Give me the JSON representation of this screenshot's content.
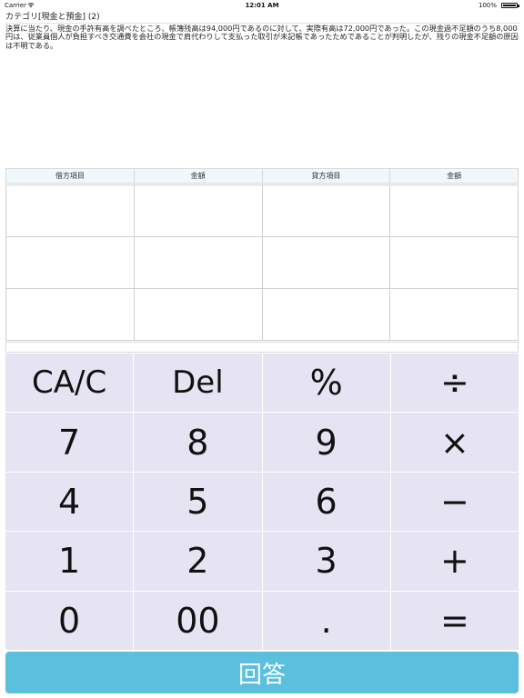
{
  "status_bar": {
    "carrier": "Carrier",
    "time": "12:01 AM",
    "battery": "100%"
  },
  "header": {
    "category": "カテゴリ[現金と預金] (2)"
  },
  "question": {
    "text": "決算に当たり、現金の手許有高を調べたところ、帳簿残高は94,000円であるのに対して、実際有高は72,000円であった。この現金過不足額のうち8,000円は、従業員個人が負担すべき交通費を会社の現金で肩代わりして支払った取引が未記帳であったためであることが判明したが、残りの現金不足額の原因は不明である。"
  },
  "journal": {
    "headers": [
      "借方項目",
      "金額",
      "貸方項目",
      "金額"
    ],
    "rows": [
      [
        "",
        "",
        "",
        ""
      ],
      [
        "",
        "",
        "",
        ""
      ],
      [
        "",
        "",
        "",
        ""
      ]
    ]
  },
  "display": {
    "value": ""
  },
  "keypad": {
    "keys": [
      "CA/C",
      "Del",
      "%",
      "÷",
      "7",
      "8",
      "9",
      "×",
      "4",
      "5",
      "6",
      "−",
      "1",
      "2",
      "3",
      "+",
      "0",
      "00",
      ".",
      "="
    ]
  },
  "answer": {
    "label": "回答"
  }
}
